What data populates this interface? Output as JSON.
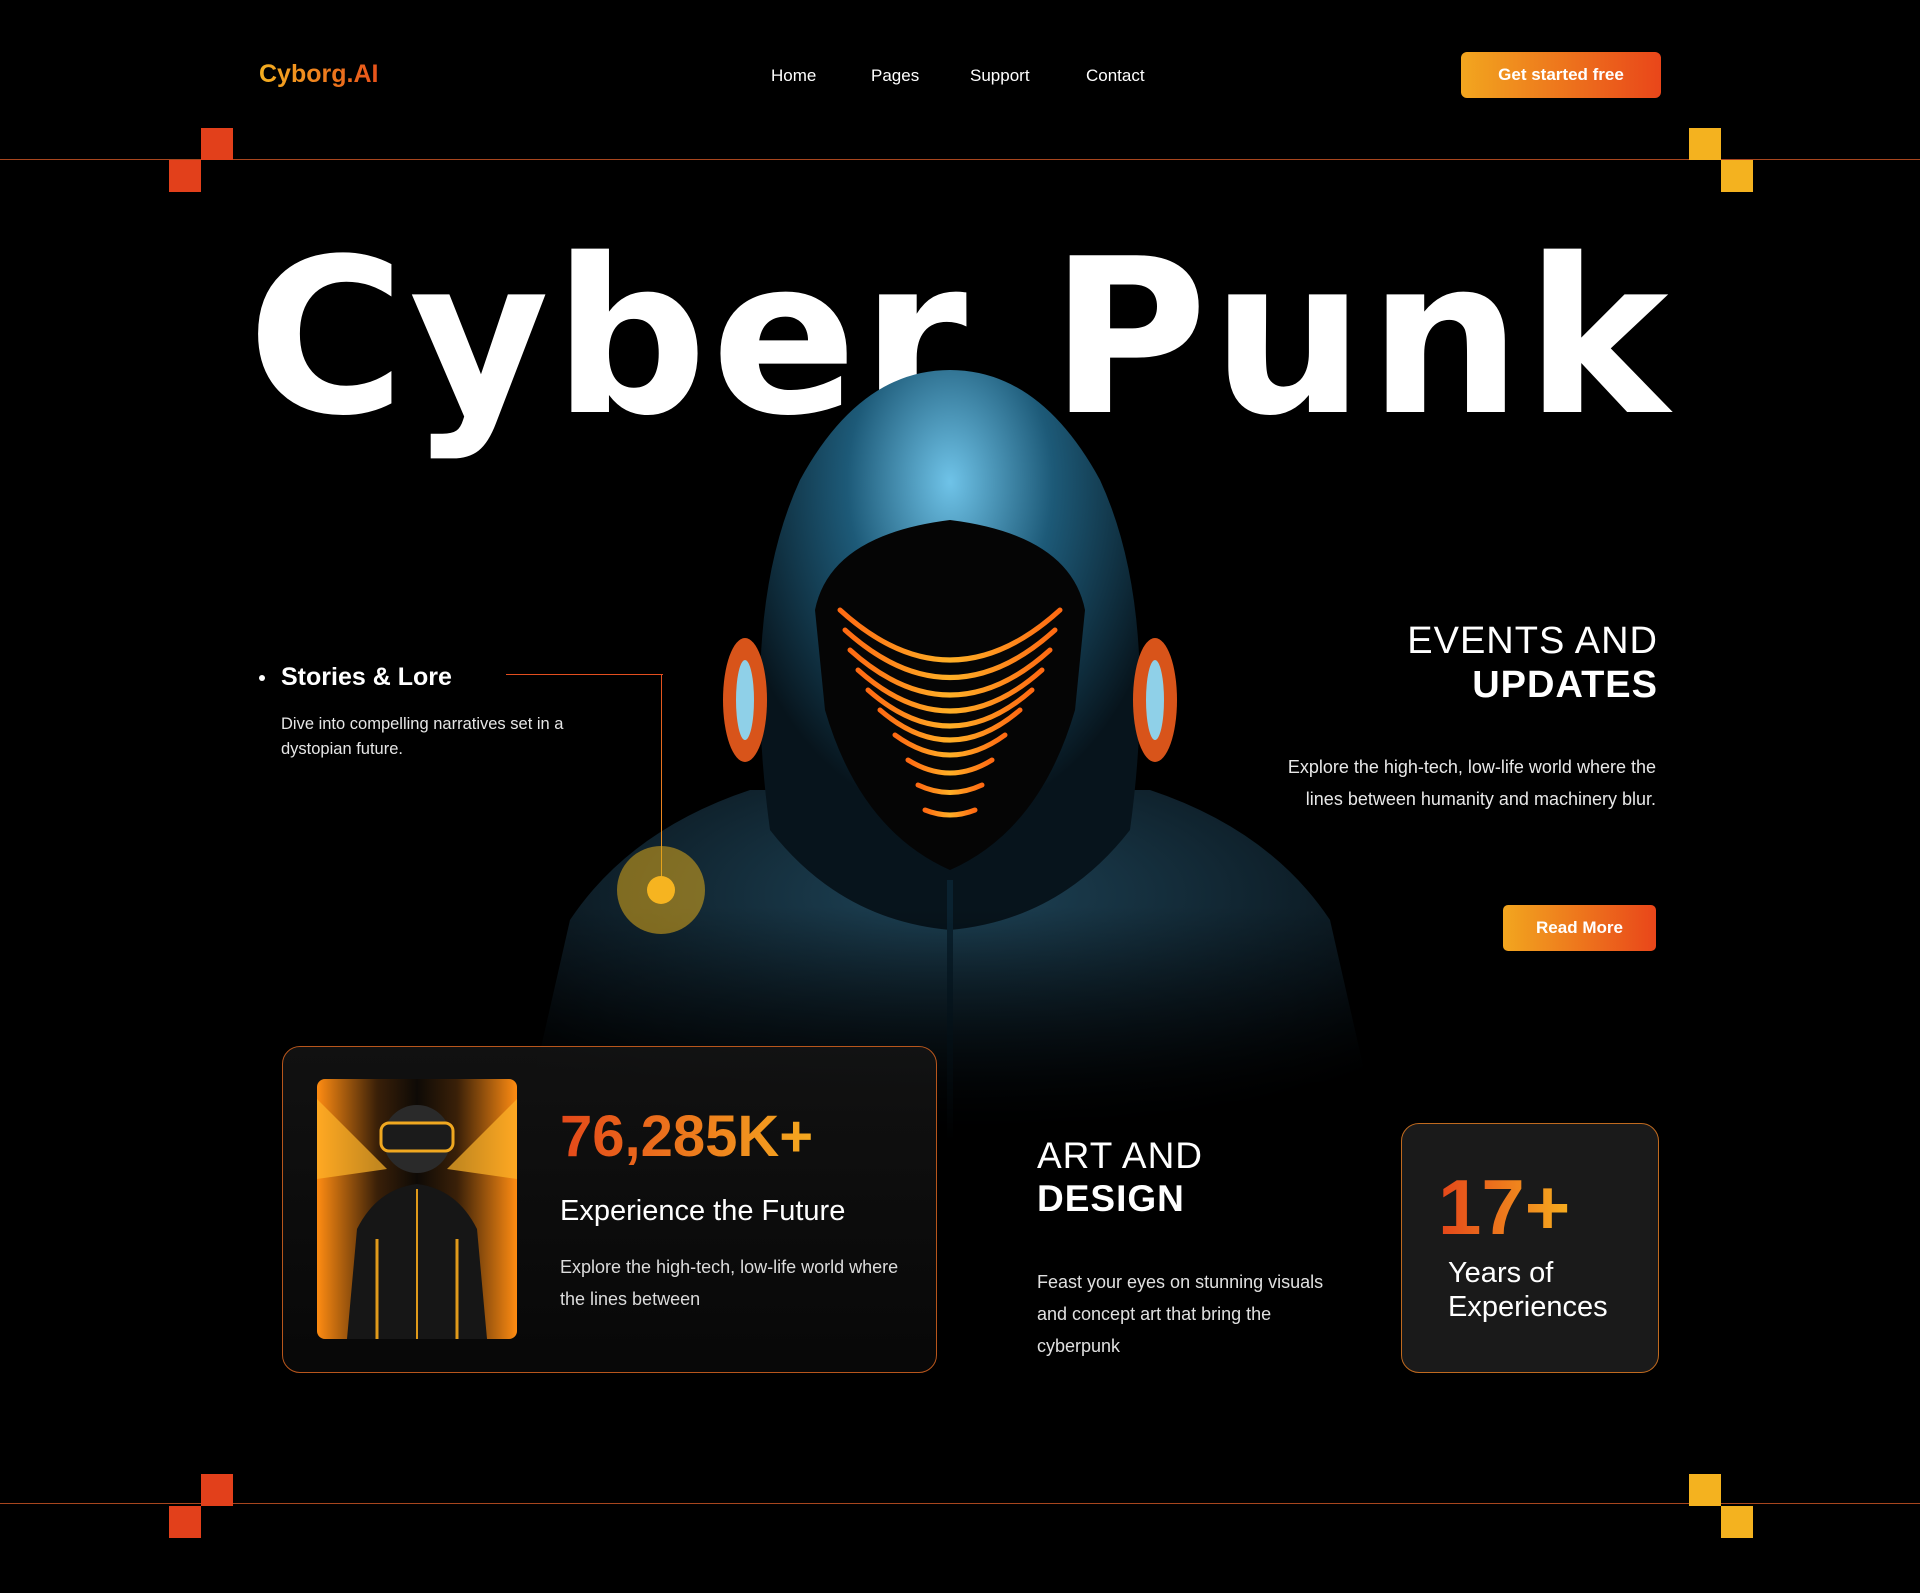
{
  "header": {
    "logo": "Cyborg.AI",
    "nav": [
      "Home",
      "Pages",
      "Support",
      "Contact"
    ],
    "cta_label": "Get started free"
  },
  "hero": {
    "title": "Cyber Punk"
  },
  "stories": {
    "title": "Stories & Lore",
    "description": "Dive into compelling narratives set in a dystopian future."
  },
  "events": {
    "title_line1": "EVENTS AND",
    "title_line2": "UPDATES",
    "description": "Explore the high-tech, low-life world where the lines between humanity and machinery blur.",
    "button_label": "Read More"
  },
  "stat_card": {
    "value": "76,285K+",
    "title": "Experience the Future",
    "description": "Explore the high-tech, low-life world where the lines between"
  },
  "art": {
    "title_line1": "ART AND",
    "title_line2": "DESIGN",
    "description": "Feast your eyes on stunning visuals and concept art that bring the cyberpunk"
  },
  "years_card": {
    "value": "17+",
    "label": "Years of Experiences"
  },
  "colors": {
    "accent_orange": "#e9461a",
    "accent_yellow": "#f4b21f",
    "background": "#000000"
  }
}
